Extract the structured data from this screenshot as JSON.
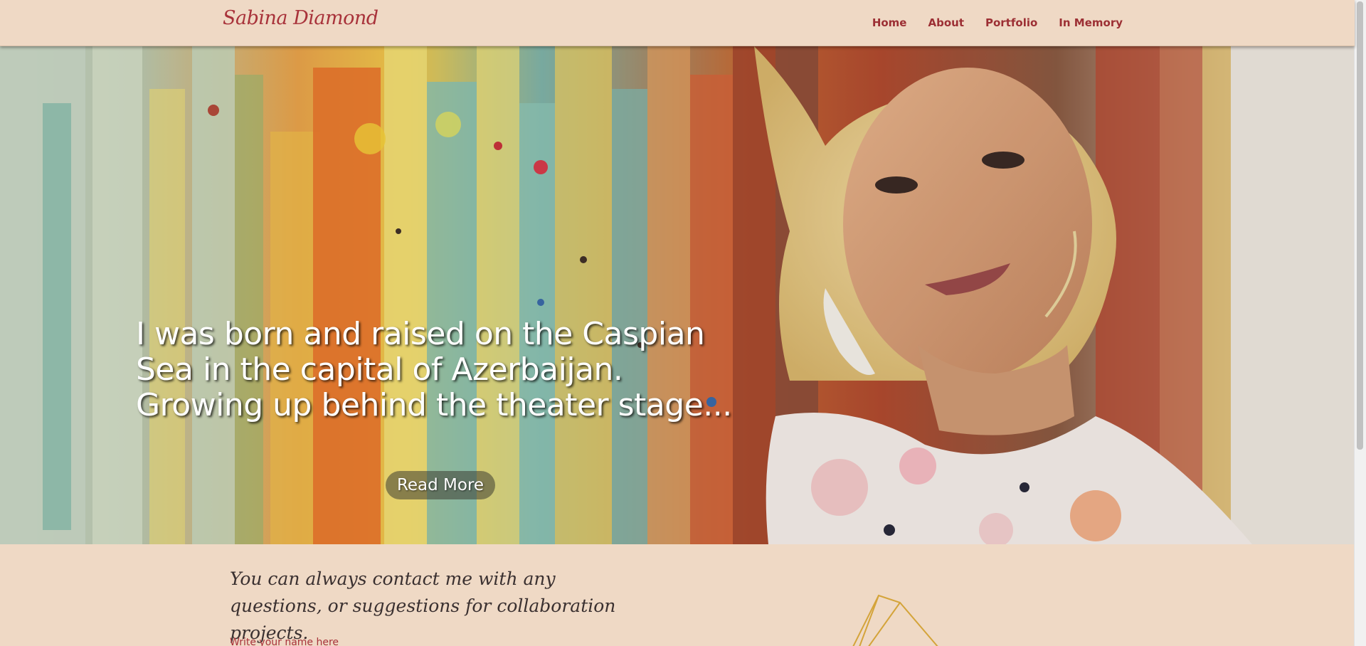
{
  "navbar": {
    "brand": "Sabina Diamond",
    "links": [
      "Home",
      "About",
      "Portfolio",
      "In Memory"
    ]
  },
  "hero": {
    "headline": "I was born and raised on the Caspian Sea in the capital of Azerbaijan. Growing up behind the theater stage...",
    "read_more_label": "Read More"
  },
  "contact": {
    "intro": "You can always contact me with any questions, or suggestions for collaboration projects.",
    "name_label": "Write your name here"
  },
  "colors": {
    "background": "#efd9c5",
    "brand": "#a8323a",
    "nav_link": "#9c2f34"
  }
}
